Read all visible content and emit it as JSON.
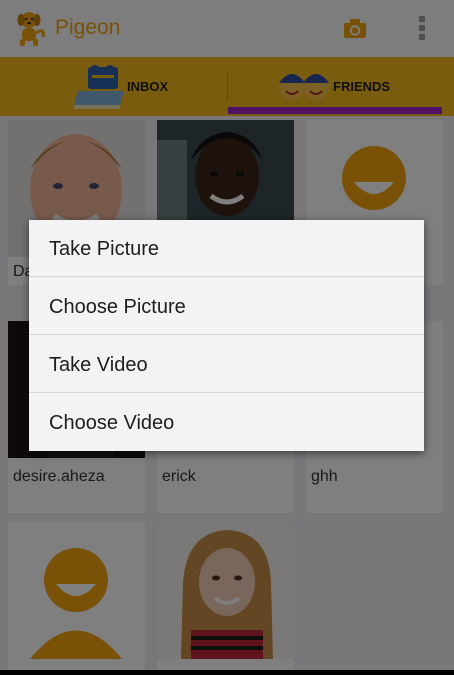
{
  "app": {
    "title": "Pigeon",
    "accent_color": "#f2a510",
    "tab_bar_color": "#f5b81e",
    "tab_indicator_color": "#a020c8"
  },
  "actionbar": {
    "logo_icon": "dog-logo-icon",
    "camera_icon": "camera-icon",
    "overflow_icon": "overflow-menu-icon"
  },
  "tabs": [
    {
      "label": "INBOX",
      "icon": "inbox-icon",
      "selected": false
    },
    {
      "label": "FRIENDS",
      "icon": "friends-icon",
      "selected": true
    }
  ],
  "friends": [
    {
      "name": "Da",
      "photo": "man-photo"
    },
    {
      "name": "",
      "photo": "woman-photo"
    },
    {
      "name": "",
      "photo": "default-avatar"
    },
    {
      "name": "desire.aheza",
      "photo": "person-photo"
    },
    {
      "name": "erick",
      "photo": "blank"
    },
    {
      "name": "ghh",
      "photo": "blank"
    },
    {
      "name": "",
      "photo": "default-avatar"
    },
    {
      "name": "",
      "photo": "girl-photo"
    }
  ],
  "dialog": {
    "options": [
      {
        "label": "Take Picture"
      },
      {
        "label": "Choose Picture"
      },
      {
        "label": "Take Video"
      },
      {
        "label": "Choose Video"
      }
    ]
  }
}
